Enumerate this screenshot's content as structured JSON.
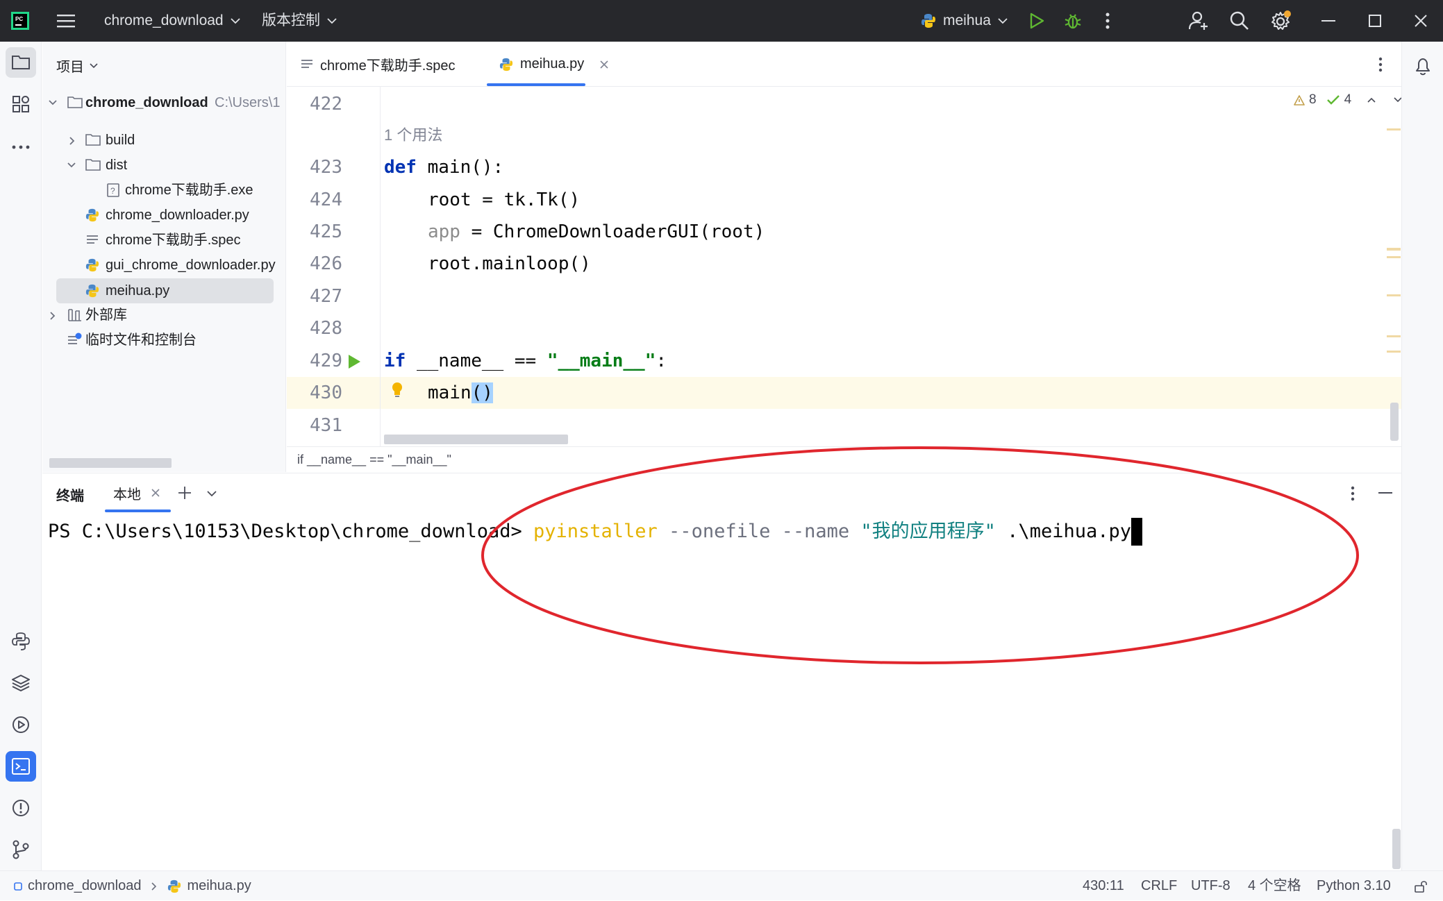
{
  "titlebar": {
    "project_name": "chrome_download",
    "vcs_menu": "版本控制",
    "run_config": "meihua"
  },
  "project_panel": {
    "title": "项目",
    "tree": [
      {
        "label": "chrome_download",
        "sub": "C:\\Users\\1",
        "type": "folder",
        "expanded": true
      },
      {
        "label": "build",
        "type": "folder",
        "expanded": false
      },
      {
        "label": "dist",
        "type": "folder",
        "expanded": true
      },
      {
        "label": "chrome下载助手.exe",
        "type": "exe"
      },
      {
        "label": "chrome_downloader.py",
        "type": "python"
      },
      {
        "label": "chrome下载助手.spec",
        "type": "text"
      },
      {
        "label": "gui_chrome_downloader.py",
        "type": "python"
      },
      {
        "label": "meihua.py",
        "type": "python",
        "selected": true
      },
      {
        "label": "外部库",
        "type": "library"
      },
      {
        "label": "临时文件和控制台",
        "type": "scratch"
      }
    ]
  },
  "tabs": [
    {
      "label": "chrome下载助手.spec",
      "active": false
    },
    {
      "label": "meihua.py",
      "active": true
    }
  ],
  "inspections": {
    "warnings": "8",
    "ok": "4"
  },
  "editor": {
    "usage_hint": "1 个用法",
    "lines": [
      {
        "num": "422"
      },
      {
        "num": "423"
      },
      {
        "num": "424"
      },
      {
        "num": "425"
      },
      {
        "num": "426"
      },
      {
        "num": "427"
      },
      {
        "num": "428"
      },
      {
        "num": "429"
      },
      {
        "num": "430"
      },
      {
        "num": "431"
      }
    ],
    "code": {
      "l423_kw": "def",
      "l423_rest": " main():",
      "l424": "root = tk.Tk()",
      "l425_var": "app",
      "l425_rest": " = ChromeDownloaderGUI(root)",
      "l426": "root.mainloop()",
      "l429_kw": "if",
      "l429_mid": " __name__ == ",
      "l429_str": "\"__main__\"",
      "l429_end": ":",
      "l430_name": "main",
      "l430_paren": "()"
    }
  },
  "breadcrumb": "if __name__ == \"__main__\"",
  "terminal": {
    "title": "终端",
    "tab": "本地",
    "prompt": "PS C:\\Users\\10153\\Desktop\\chrome_download> ",
    "cmd": "pyinstaller",
    "opts": " --onefile --name ",
    "arg": "\"我的应用程序\"",
    "path": " .\\meihua.py"
  },
  "statusbar": {
    "project": "chrome_download",
    "file": "meihua.py",
    "position": "430:11",
    "line_sep": "CRLF",
    "encoding": "UTF-8",
    "indent": "4 个空格",
    "interpreter": "Python 3.10"
  },
  "colors": {
    "titlebar_bg": "#27282c",
    "annotation_red": "#e0262d",
    "keyword": "#0033b3",
    "string": "#067d17",
    "terminal_cmd": "#e4b200",
    "terminal_arg": "#108080"
  }
}
